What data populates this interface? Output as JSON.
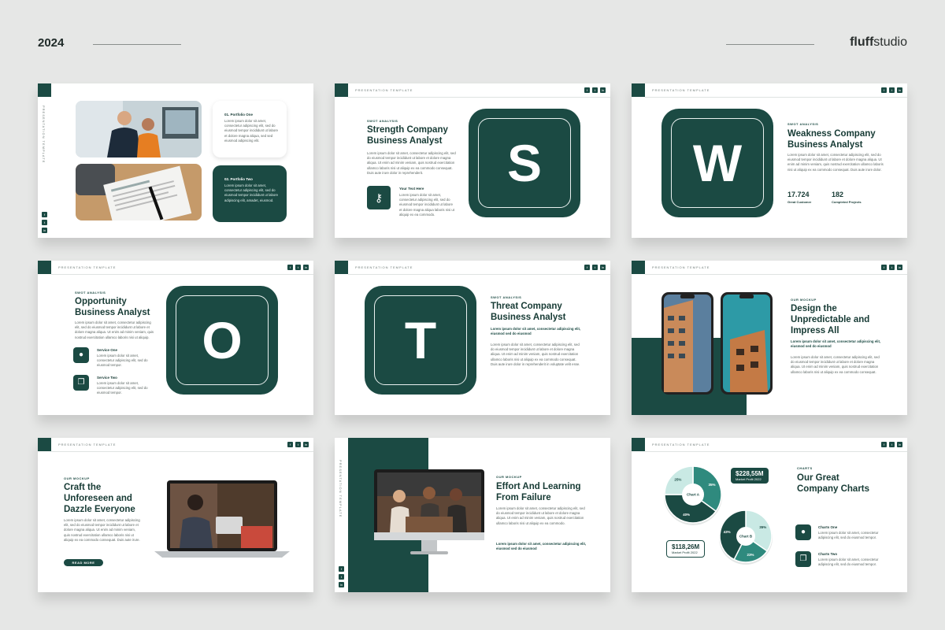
{
  "header": {
    "year": "2024",
    "brand_bold": "fluff",
    "brand_rest": "studio"
  },
  "common": {
    "template_label": "PRESENTATION TEMPLATE",
    "social": [
      "f",
      "t",
      "in"
    ]
  },
  "s1": {
    "vertical_label": "PRESENTATION TEMPLATE",
    "item1_title": "01. Portfolio One",
    "item1_text": "Lorem ipsum dolor sit amet, consectetur adipiscing elit, sed do eiusmod tempor incididunt ut labore et dolore magna aliqua, sed sed eiusmod adipiscing elit.",
    "item2_title": "02. Portfolio Two",
    "item2_text": "Lorem ipsum dolor sit amet, consectetur adipiscing elit, sed do eiusmod tempor incididunt ut labore adipiscing elit, amadet, eiusmod."
  },
  "s2": {
    "eyebrow": "SWOT ANALYSIS",
    "title": "Strength Company Business Analyst",
    "text": "Lorem ipsum dolor sit amet, consectetur adipiscing elit, sed do eiusmod tempor incididunt ut labore et dolore magna aliqua. Ut enim ad minim veniam, quis nostrud exercitation ullamco laboris nisi ut aliquip ex ea commodo consequat. Duis aute irure dolor in reprehenderit.",
    "sub_title": "Your Text Here",
    "sub_text": "Lorem ipsum dolor sit amet, consectetur adipiscing elit, sed do eiusmod tempor incididunt ut labore et dolore magna aliqua laboris nisi ut aliquip ex ea commodo.",
    "letter": "S"
  },
  "s3": {
    "eyebrow": "SWOT ANALYSIS",
    "title": "Weakness Company Business Analyst",
    "text": "Lorem ipsum dolor sit amet, consectetur adipiscing elit, sed do eiusmod tempor incididunt ut labore et dolore magna aliqua. Ut enim ad minim veniam, quis nostrud exercitation ullamco laboris nisi ut aliquip ex ea commodo consequat. Duis aute irure dolor.",
    "letter": "W",
    "stat1_value": "17.724",
    "stat1_label": "Great Customer",
    "stat2_value": "182",
    "stat2_label": "Completed Projects"
  },
  "s4": {
    "eyebrow": "SWOT ANALYSIS",
    "title": "Opportunity Business Analyst",
    "text": "Lorem ipsum dolor sit amet, consectetur adipiscing elit, sed do eiusmod tempor incididunt ut labore et dolore magna aliqua. Ut enim ad minim veniam, quis nostrud exercitation ullamco laboris nisi ut aliquip.",
    "service1": "Service One",
    "service1_text": "Lorem ipsum dolor sit amet, consectetur adipiscing elit, sed do eiusmod tempor.",
    "service2": "Service Two",
    "service2_text": "Lorem ipsum dolor sit amet, consectetur adipiscing elit, sed do eiusmod tempor.",
    "letter": "O"
  },
  "s5": {
    "eyebrow": "SWOT ANALYSIS",
    "title": "Threat Company Business Analyst",
    "lead": "Lorem ipsum dolor sit amet, consectetur adipiscing elit, eiusmod sed do eiusmod",
    "text": "Lorem ipsum dolor sit amet, consectetur adipiscing elit, sed do eiusmod tempor incididunt ut labore et dolore magna aliqua. Ut enim ad minim veniam, quis nostrud exercitation ullamco laboris nisi ut aliquip ex ea commodo consequat. Duis aute irure dolor in reprehenderit in voluptate velit esse.",
    "letter": "T"
  },
  "s6": {
    "eyebrow": "OUR MOCKUP",
    "title": "Design the Unpredictable and Impress All",
    "lead": "Lorem ipsum dolor sit amet, consectetur adipiscing elit, eiusmod sed do eiusmod",
    "text": "Lorem ipsum dolor sit amet, consectetur adipiscing elit, sed do eiusmod tempor incididunt ut labore et dolore magna aliqua. Ut enim ad minim veniam, quis nostrud exercitation ullamco laboris nisi ut aliquip ex ea commodo consequat."
  },
  "s7": {
    "eyebrow": "OUR MOCKUP",
    "title": "Craft the Unforeseen and Dazzle Everyone",
    "text": "Lorem ipsum dolor sit amet, consectetur adipiscing elit, sed do eiusmod tempor incididunt ut labore et dolore magna aliqua. Ut enim ad minim veniam, quis nostrud exercitation ullamco laboris nisi ut aliquip ex ea commodo consequat. Duis aute irure.",
    "button": "READ MORE"
  },
  "s8": {
    "vertical_label": "PRESENTATION TEMPLATE",
    "eyebrow": "OUR MOCKUP",
    "title": "Effort And Learning From Failure",
    "text": "Lorem ipsum dolor sit amet, consectetur adipiscing elit, sed do eiusmod tempor incididunt ut labore et dolore magna aliqua. Ut enim ad minim veniam, quis nostrud exercitation ullamco laboris nisi ut aliquip ex ea commodo.",
    "lead": "Lorem ipsum dolor sit amet, consectetur adipiscing elit, eiusmod sed do eiusmod"
  },
  "s9": {
    "eyebrow": "CHARTS",
    "title": "Our Great Company Charts",
    "chartA_label": "Chart A",
    "chartB_label": "Chart B",
    "callout1_value": "$228,55M",
    "callout1_label": "Market Profit 2022",
    "callout2_value": "$118,26M",
    "callout2_label": "Market Profit 2022",
    "item1": "Charts One",
    "item1_text": "Lorem ipsum dolor sit amet, consectetur adipiscing elit, sed do eiusmod tempor.",
    "item2": "Charts Two",
    "item2_text": "Lorem ipsum dolor sit amet, consectetur adipiscing elit, sed do eiusmod tempor."
  },
  "chart_data": [
    {
      "type": "pie",
      "title": "Chart A",
      "categories": [
        "",
        "",
        ""
      ],
      "values": [
        35,
        40,
        25
      ],
      "labels": [
        "35%",
        "40%",
        "25%"
      ],
      "colors": [
        "#2f8a7e",
        "#1b4a43",
        "#c9e9e4"
      ]
    },
    {
      "type": "pie",
      "title": "Chart B",
      "categories": [
        "",
        "",
        ""
      ],
      "values": [
        35,
        23,
        43
      ],
      "labels": [
        "35%",
        "23%",
        "43%"
      ],
      "colors": [
        "#c9e9e4",
        "#2f8a7e",
        "#1b4a43"
      ]
    }
  ]
}
